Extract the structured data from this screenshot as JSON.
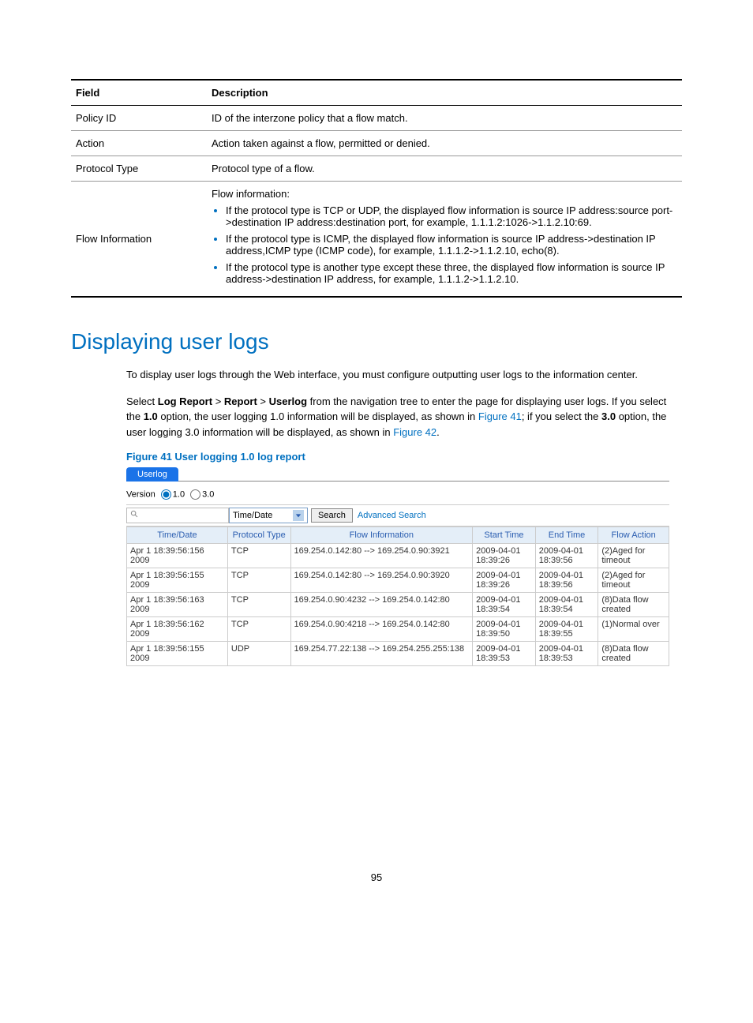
{
  "doc_table": {
    "headers": {
      "field": "Field",
      "description": "Description"
    },
    "rows": [
      {
        "field": "Policy ID",
        "desc": "ID of the interzone policy that a flow match."
      },
      {
        "field": "Action",
        "desc": "Action taken against a flow, permitted or denied."
      },
      {
        "field": "Protocol Type",
        "desc": "Protocol type of a flow."
      },
      {
        "field": "Flow Information",
        "desc_intro": "Flow information:",
        "bullets": [
          "If the protocol type is TCP or UDP, the displayed flow information is source IP address:source port->destination IP address:destination port, for example, 1.1.1.2:1026->1.1.2.10:69.",
          "If the protocol type is ICMP, the displayed flow information is source IP address->destination IP address,ICMP type (ICMP code), for example, 1.1.1.2->1.1.2.10, echo(8).",
          "If the protocol type is another type except these three, the displayed flow information is source IP address->destination IP address, for example, 1.1.1.2->1.1.2.10."
        ]
      }
    ]
  },
  "section": {
    "heading": "Displaying user logs",
    "para1": "To display user logs through the Web interface, you must configure outputting user logs to the information center.",
    "para2_pre": "Select ",
    "para2_b1": "Log Report",
    "para2_gt1": " > ",
    "para2_b2": "Report",
    "para2_gt2": " > ",
    "para2_b3": "Userlog",
    "para2_mid1": " from the navigation tree to enter the page for displaying user logs. If you select the ",
    "para2_b4": "1.0",
    "para2_mid2": " option, the user logging 1.0 information will be displayed, as shown in ",
    "para2_link1": "Figure 41",
    "para2_mid3": "; if you select the ",
    "para2_b5": "3.0",
    "para2_mid4": " option, the user logging 3.0 information will be displayed, as shown in ",
    "para2_link2": "Figure 42",
    "para2_end": "."
  },
  "figure": {
    "caption": "Figure 41 User logging 1.0 log report",
    "tab": "Userlog",
    "version_label": "Version",
    "radio1": "1.0",
    "radio2": "3.0",
    "select_value": "Time/Date",
    "search_btn": "Search",
    "advanced": "Advanced Search",
    "columns": {
      "time": "Time/Date",
      "proto": "Protocol Type",
      "flow": "Flow Information",
      "start": "Start Time",
      "end": "End Time",
      "action": "Flow Action"
    },
    "rows": [
      {
        "time": "Apr 1 18:39:56:156 2009",
        "proto": "TCP",
        "flow": "169.254.0.142:80 --> 169.254.0.90:3921",
        "start": "2009-04-01 18:39:26",
        "end": "2009-04-01 18:39:56",
        "action": "(2)Aged for timeout"
      },
      {
        "time": "Apr 1 18:39:56:155 2009",
        "proto": "TCP",
        "flow": "169.254.0.142:80 --> 169.254.0.90:3920",
        "start": "2009-04-01 18:39:26",
        "end": "2009-04-01 18:39:56",
        "action": "(2)Aged for timeout"
      },
      {
        "time": "Apr 1 18:39:56:163 2009",
        "proto": "TCP",
        "flow": "169.254.0.90:4232 --> 169.254.0.142:80",
        "start": "2009-04-01 18:39:54",
        "end": "2009-04-01 18:39:54",
        "action": "(8)Data flow created"
      },
      {
        "time": "Apr 1 18:39:56:162 2009",
        "proto": "TCP",
        "flow": "169.254.0.90:4218 --> 169.254.0.142:80",
        "start": "2009-04-01 18:39:50",
        "end": "2009-04-01 18:39:55",
        "action": "(1)Normal over"
      },
      {
        "time": "Apr 1 18:39:56:155 2009",
        "proto": "UDP",
        "flow": "169.254.77.22:138 --> 169.254.255.255:138",
        "start": "2009-04-01 18:39:53",
        "end": "2009-04-01 18:39:53",
        "action": "(8)Data flow created"
      }
    ]
  },
  "page_number": "95"
}
